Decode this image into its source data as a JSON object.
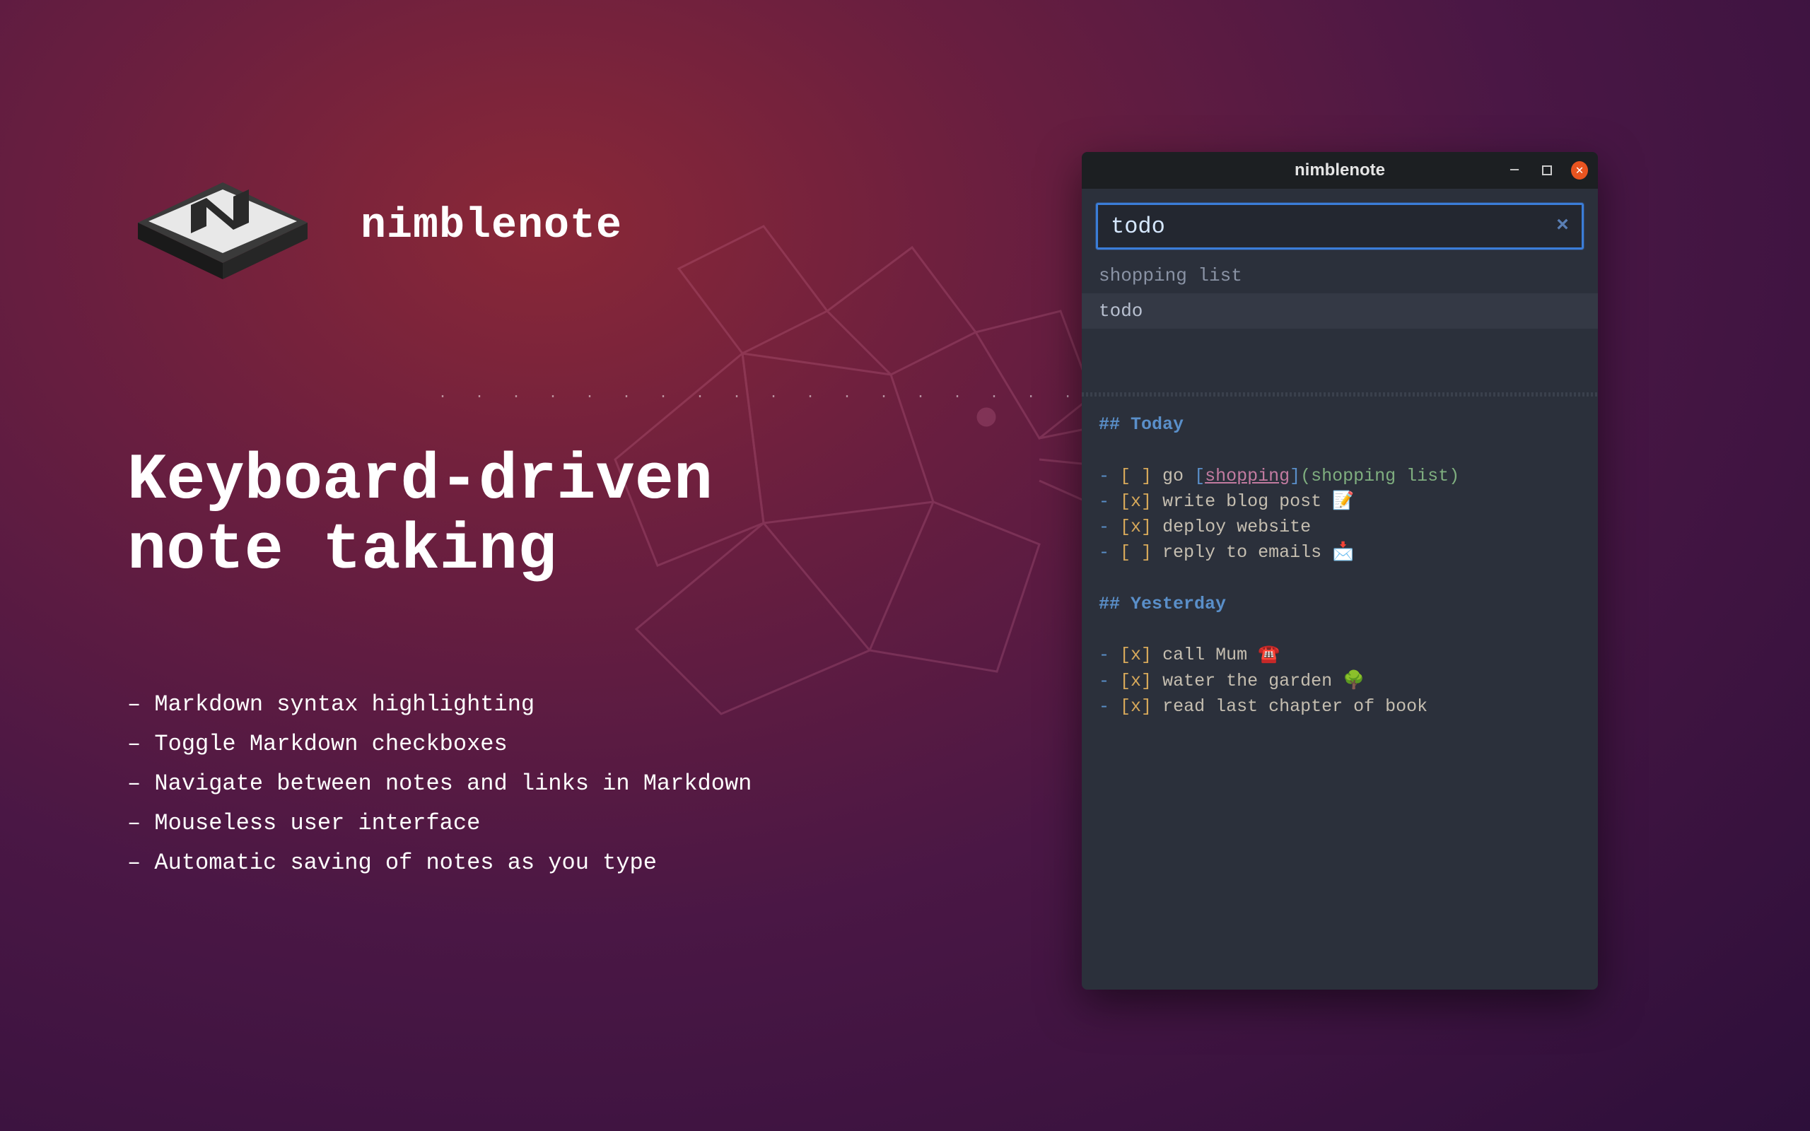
{
  "marketing": {
    "app_name": "nimblenote",
    "headline": "Keyboard-driven\nnote taking",
    "features": [
      "Markdown syntax highlighting",
      "Toggle Markdown checkboxes",
      "Navigate between notes and links in Markdown",
      "Mouseless user interface",
      "Automatic saving of notes as you type"
    ]
  },
  "window": {
    "title": "nimblenote",
    "search": {
      "value": "todo"
    },
    "notes": [
      {
        "title": "shopping list",
        "selected": false
      },
      {
        "title": "todo",
        "selected": true
      }
    ],
    "editor": {
      "sections": [
        {
          "heading": "Today",
          "items": [
            {
              "checked": false,
              "text": "go ",
              "link_text": "shopping",
              "link_target": "shopping list"
            },
            {
              "checked": true,
              "text": "write blog post ",
              "emoji": "📝"
            },
            {
              "checked": true,
              "text": "deploy website"
            },
            {
              "checked": false,
              "text": "reply to emails ",
              "emoji": "📩"
            }
          ]
        },
        {
          "heading": "Yesterday",
          "items": [
            {
              "checked": true,
              "text": "call Mum ",
              "emoji": "☎️"
            },
            {
              "checked": true,
              "text": "water the garden ",
              "emoji": "🌳"
            },
            {
              "checked": true,
              "text": "read last chapter of book"
            }
          ]
        }
      ]
    }
  },
  "colors": {
    "accent_orange": "#e95420",
    "accent_blue": "#3b7dd8",
    "editor_bg": "#2b303b"
  }
}
